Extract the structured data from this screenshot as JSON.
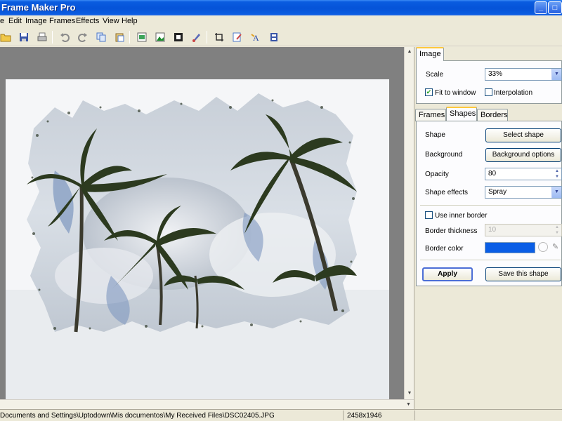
{
  "window": {
    "title": "Frame Maker Pro"
  },
  "menu": [
    "e",
    "Edit",
    "Image",
    "Frames",
    "Effects",
    "View",
    "Help"
  ],
  "toolbar": {
    "icons": [
      "open-folder-icon",
      "save-icon",
      "print-icon",
      "undo-icon",
      "redo-icon",
      "copy-icon",
      "paste-icon",
      "image-icon",
      "landscape-icon",
      "frame-icon",
      "brush-icon",
      "crop-icon",
      "edit-icon",
      "text-effect-icon",
      "film-icon"
    ]
  },
  "image_panel": {
    "tab": "Image",
    "scale_label": "Scale",
    "scale_value": "33%",
    "fit_label": "Fit to window",
    "fit_checked": true,
    "interp_label": "Interpolation",
    "interp_checked": false
  },
  "tabs": {
    "frames": "Frames",
    "shapes": "Shapes",
    "borders": "Borders",
    "active": "Shapes"
  },
  "shapes": {
    "shape_label": "Shape",
    "shape_button": "Select shape",
    "background_label": "Background",
    "background_button": "Background options",
    "opacity_label": "Opacity",
    "opacity_value": "80",
    "effects_label": "Shape effects",
    "effects_value": "Spray",
    "inner_border_label": "Use inner border",
    "inner_border_checked": false,
    "thickness_label": "Border thickness",
    "thickness_value": "10",
    "color_label": "Border color",
    "color_value": "#0a5ee6",
    "apply_button": "Apply",
    "save_button": "Save this shape"
  },
  "status": {
    "path": "Documents and Settings\\Uptodown\\Mis documentos\\My Received Files\\DSC02405.JPG",
    "dimensions": "2458x1946"
  },
  "colors": {
    "titlebar": "#0553d8",
    "canvas_bg": "#808080",
    "accent": "#ffc83c"
  }
}
